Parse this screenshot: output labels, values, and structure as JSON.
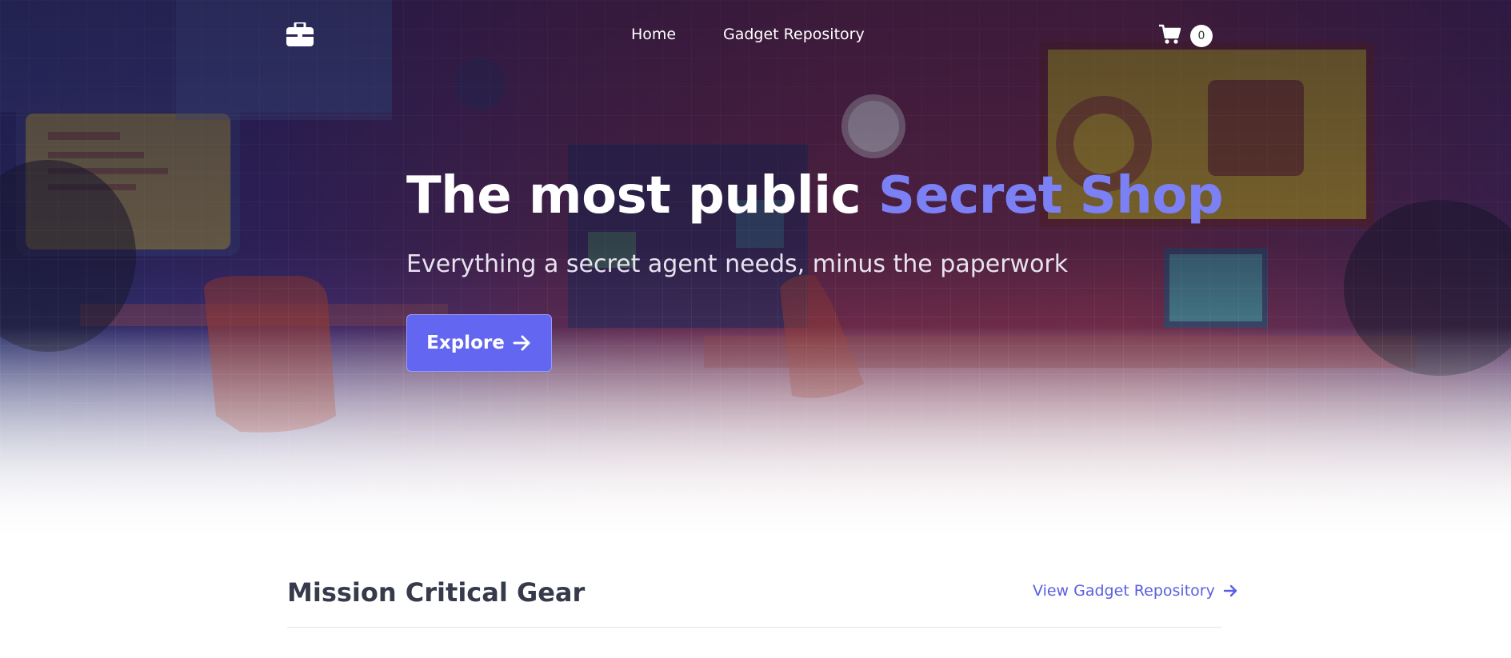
{
  "nav": {
    "logo_icon": "briefcase-icon",
    "links": [
      {
        "label": "Home"
      },
      {
        "label": "Gadget Repository"
      }
    ],
    "cart": {
      "icon": "shopping-cart-icon",
      "count": "0"
    }
  },
  "hero": {
    "title_main": "The most public ",
    "title_accent": "Secret Shop",
    "subtitle": "Everything a secret agent needs, minus the paperwork",
    "button_label": "Explore",
    "button_icon": "arrow-right-icon"
  },
  "section": {
    "title": "Mission Critical Gear",
    "link_label": "View Gadget Repository",
    "link_icon": "arrow-right-icon"
  },
  "colors": {
    "accent": "#6366f1",
    "accent_text": "#7b80f4",
    "heading": "#363a4b",
    "link": "#5a5fe0"
  }
}
